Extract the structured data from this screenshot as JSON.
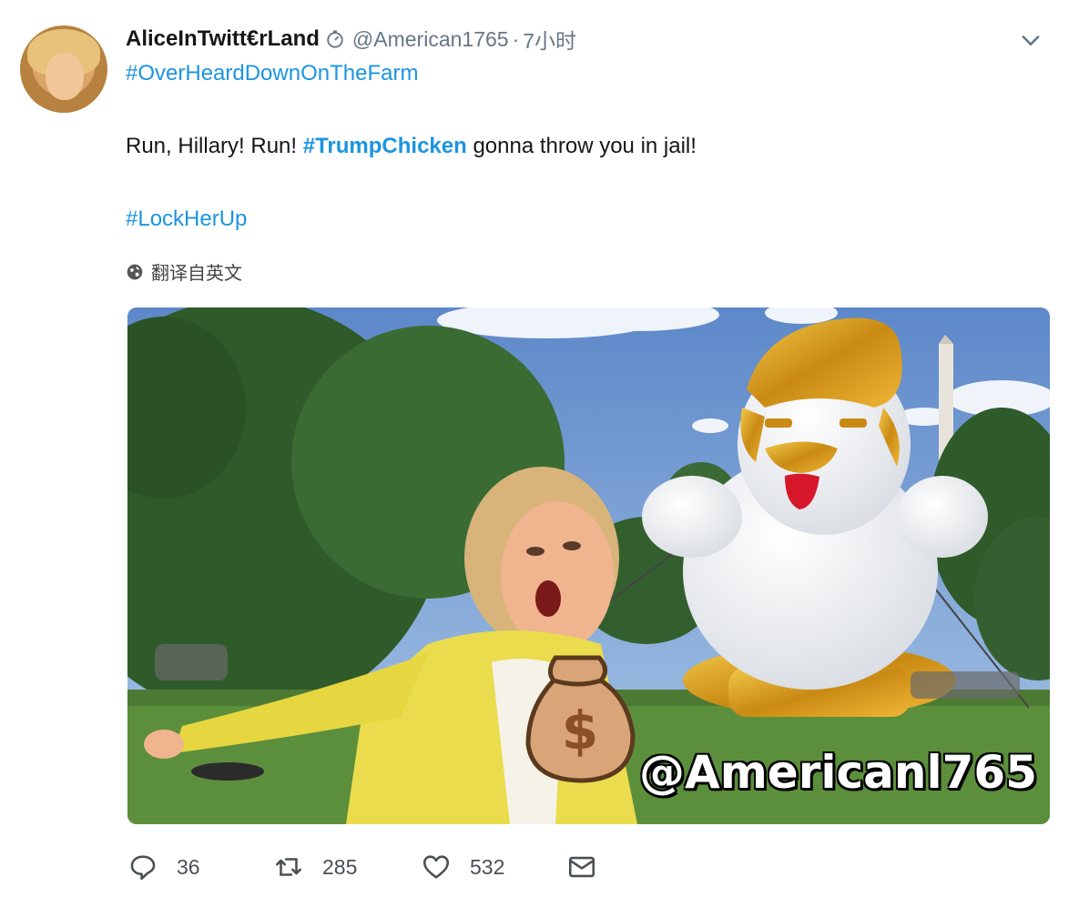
{
  "tweet": {
    "display_name": "AliceInTwitt€rLand",
    "handle": "@American1765",
    "separator": "·",
    "time": "7小时",
    "hashtag_top": "#OverHeardDownOnTheFarm",
    "body_before": "Run, Hillary! Run! ",
    "body_tag": "#TrumpChicken",
    "body_after": " gonna throw you in jail!",
    "hashtag_bottom": "#LockHerUp",
    "translate_label": "翻译自英文",
    "media": {
      "watermark": "@Americanl765",
      "bag_symbol": "$"
    },
    "actions": {
      "replies": "36",
      "retweets": "285",
      "likes": "532"
    }
  },
  "icons": {
    "verified_badge": "stopwatch-icon",
    "menu": "chevron-down-icon",
    "translate": "globe-icon",
    "reply": "reply-icon",
    "retweet": "retweet-icon",
    "like": "heart-icon",
    "dm": "envelope-icon"
  },
  "colors": {
    "link": "#1b95e0",
    "text": "#14171a",
    "muted": "#657786"
  }
}
